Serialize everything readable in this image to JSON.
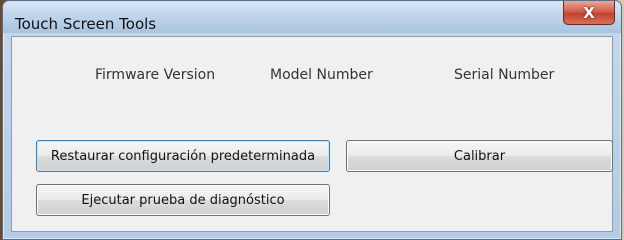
{
  "window": {
    "title": "Touch Screen Tools",
    "close_label": "X"
  },
  "info": {
    "firmware_label": "Firmware Version",
    "model_label": "Model Number",
    "serial_label": "Serial Number"
  },
  "buttons": {
    "restore_defaults": "Restaurar configuración predeterminada",
    "calibrate": "Calibrar",
    "run_diagnostic": "Ejecutar prueba de diagnóstico"
  }
}
